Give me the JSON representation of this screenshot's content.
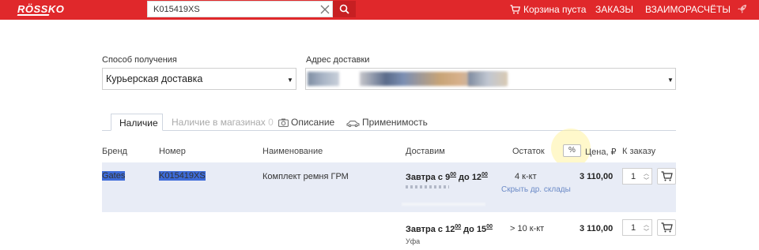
{
  "header": {
    "logo": "RÖSSKO",
    "search_value": "K015419XS",
    "cart_label": "Корзина пуста",
    "nav": [
      "ЗАКАЗЫ",
      "ВЗАИМОРАСЧЁТЫ"
    ]
  },
  "delivery": {
    "method_label": "Способ получения",
    "method_value": "Курьерская доставка",
    "address_label": "Адрес доставки"
  },
  "tabs": {
    "in_stock": "Наличие",
    "in_stores": "Наличие в магазинах",
    "in_stores_count": "0",
    "description": "Описание",
    "applicability": "Применимость"
  },
  "table": {
    "headers": {
      "brand": "Бренд",
      "number": "Номер",
      "name": "Наименование",
      "deliver": "Доставим",
      "stock": "Остаток",
      "percent": "%",
      "price": "Цена, ₽",
      "order": "К заказу"
    },
    "rows": [
      {
        "brand": "Gates",
        "number": "K015419XS",
        "name": "Комплект ремня ГРМ",
        "deliver_prefix": "Завтра с 9",
        "deliver_from_min": "00",
        "deliver_mid": " до 12",
        "deliver_to_min": "00",
        "stock": "4 к-кт",
        "stock_link": "Скрыть др. склады",
        "price": "3 110,00",
        "qty": "1"
      },
      {
        "deliver_prefix": "Завтра с 12",
        "deliver_from_min": "00",
        "deliver_mid": " до 15",
        "deliver_to_min": "00",
        "deliver_city": "Уфа",
        "stock": "> 10 к-кт",
        "price": "3 110,00",
        "qty": "1"
      }
    ]
  },
  "colors": {
    "brand_red": "#e0282b",
    "row_highlight": "#e8ecf6",
    "selection": "#3d6bd8",
    "link": "#6c8bc7"
  }
}
